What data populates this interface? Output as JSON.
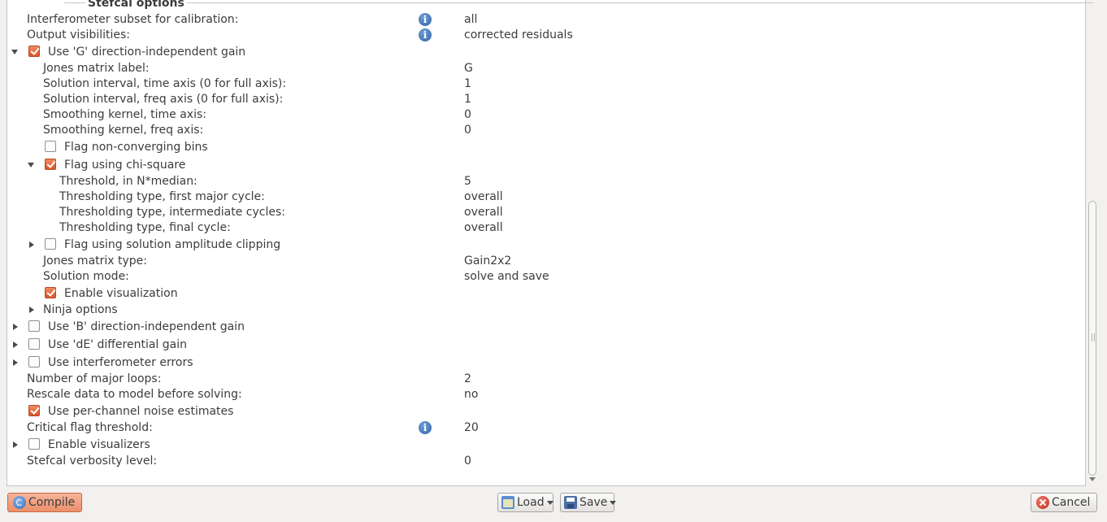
{
  "group_title": "Stefcal options",
  "rows": [
    {
      "label": "Interferometer subset for calibration:",
      "value": "all",
      "info": true
    },
    {
      "label": "Output visibilities:",
      "value": "corrected residuals",
      "info": true
    },
    {
      "label": "Use 'G' direction-independent gain",
      "checked": true,
      "expander": "expanded"
    },
    {
      "label": "Jones matrix label:",
      "value": "G"
    },
    {
      "label": "Solution interval, time axis (0 for full axis):",
      "value": "1"
    },
    {
      "label": "Solution interval, freq axis (0 for full axis):",
      "value": "1"
    },
    {
      "label": "Smoothing kernel, time axis:",
      "value": "0"
    },
    {
      "label": "Smoothing kernel, freq axis:",
      "value": "0"
    },
    {
      "label": "Flag non-converging bins",
      "checked": false
    },
    {
      "label": "Flag using chi-square",
      "checked": true,
      "expander": "expanded"
    },
    {
      "label": "Threshold, in N*median:",
      "value": "5"
    },
    {
      "label": "Thresholding type, first major cycle:",
      "value": "overall"
    },
    {
      "label": "Thresholding type, intermediate cycles:",
      "value": "overall"
    },
    {
      "label": "Thresholding type, final cycle:",
      "value": "overall"
    },
    {
      "label": "Flag using solution amplitude clipping",
      "checked": false,
      "expander": "collapsed"
    },
    {
      "label": "Jones matrix type:",
      "value": "Gain2x2"
    },
    {
      "label": "Solution mode:",
      "value": "solve and save"
    },
    {
      "label": "Enable visualization",
      "checked": true
    },
    {
      "label": "Ninja options",
      "expander": "collapsed"
    },
    {
      "label": "Use 'B' direction-independent gain",
      "checked": false,
      "expander": "collapsed"
    },
    {
      "label": "Use 'dE' differential gain",
      "checked": false,
      "expander": "collapsed"
    },
    {
      "label": "Use interferometer errors",
      "checked": false,
      "expander": "collapsed"
    },
    {
      "label": "Number of major loops:",
      "value": "2"
    },
    {
      "label": "Rescale data to model before solving:",
      "value": "no"
    },
    {
      "label": "Use per-channel noise estimates",
      "checked": true
    },
    {
      "label": "Critical flag threshold:",
      "value": "20",
      "info": true
    },
    {
      "label": "Enable visualizers",
      "checked": false,
      "expander": "collapsed"
    },
    {
      "label": "Stefcal verbosity level:",
      "value": "0"
    }
  ],
  "buttons": {
    "compile": "Compile",
    "load": "Load",
    "save": "Save",
    "cancel": "Cancel"
  },
  "icons": {
    "info": "info-icon",
    "compile": "compile-icon",
    "load": "folder-open-icon",
    "save": "floppy-disk-icon",
    "cancel": "cancel-icon"
  },
  "colors": {
    "checkbox_checked": "#e0622f",
    "info_icon": "#2f63a8",
    "panel_bg": "#ffffff",
    "window_bg": "#f2f1f0"
  }
}
